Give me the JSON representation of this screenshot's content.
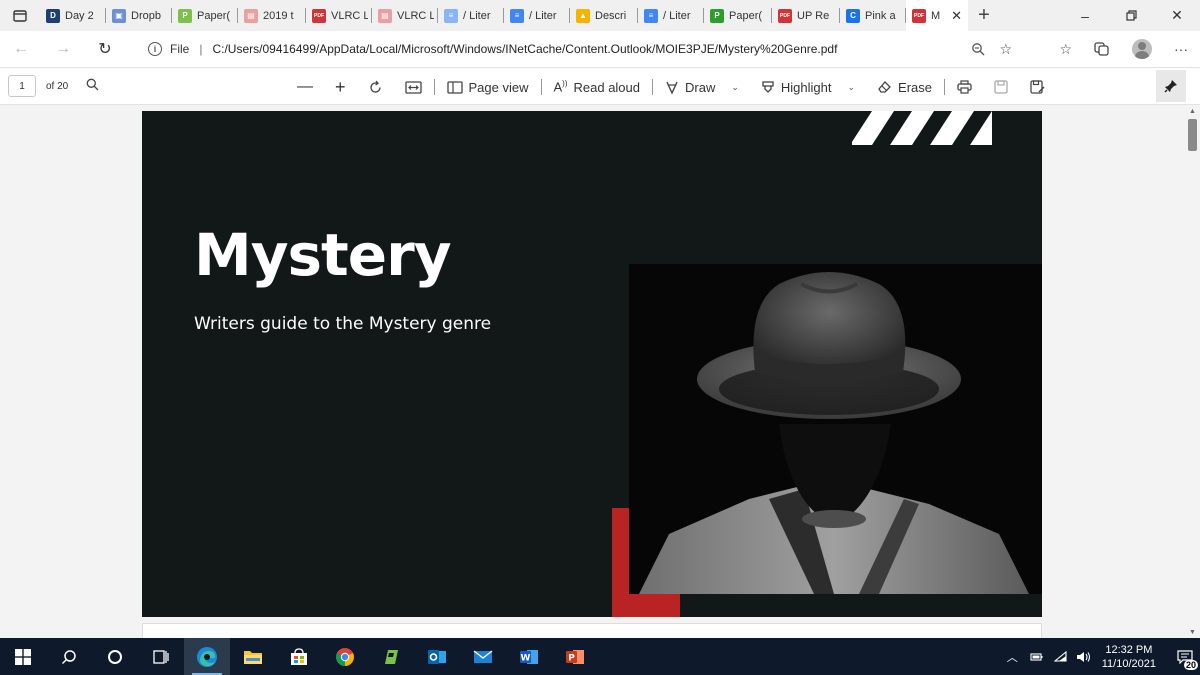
{
  "browser": {
    "tabs": [
      {
        "title": "Day 2",
        "fav_color": "#1d3f73",
        "fav_glyph": "D"
      },
      {
        "title": "Dropb",
        "fav_color": "#6e8fd6",
        "fav_glyph": "▣"
      },
      {
        "title": "Paper(",
        "fav_color": "#7cc24a",
        "fav_glyph": "P"
      },
      {
        "title": "2019 t",
        "fav_color": "#e8a0a0",
        "fav_glyph": "▤"
      },
      {
        "title": "VLRC L",
        "fav_color": "#d13438",
        "fav_glyph": "PDF"
      },
      {
        "title": "VLRC L",
        "fav_color": "#e8a0a0",
        "fav_glyph": "▤"
      },
      {
        "title": "/ Liter",
        "fav_color": "#8ab4f8",
        "fav_glyph": "≡"
      },
      {
        "title": "/ Liter",
        "fav_color": "#4285f4",
        "fav_glyph": "≡"
      },
      {
        "title": "Descri",
        "fav_color": "#f4b400",
        "fav_glyph": "▲"
      },
      {
        "title": "/ Liter",
        "fav_color": "#4285f4",
        "fav_glyph": "≡"
      },
      {
        "title": "Paper(",
        "fav_color": "#2e9c2e",
        "fav_glyph": "P"
      },
      {
        "title": "UP Re",
        "fav_color": "#d13438",
        "fav_glyph": "PDF"
      },
      {
        "title": "Pink a",
        "fav_color": "#1a73e8",
        "fav_glyph": "C"
      },
      {
        "title": "M",
        "fav_color": "#d13438",
        "fav_glyph": "PDF",
        "active": true
      }
    ],
    "address": {
      "scheme_label": "File",
      "url": "C:/Users/09416499/AppData/Local/Microsoft/Windows/INetCache/Content.Outlook/MOIE3PJE/Mystery%20Genre.pdf"
    }
  },
  "pdf_toolbar": {
    "page_number": "1",
    "page_total": "of 20",
    "page_view": "Page view",
    "read_aloud": "Read aloud",
    "draw": "Draw",
    "highlight": "Highlight",
    "erase": "Erase"
  },
  "slide": {
    "title": "Mystery",
    "subtitle": "Writers guide to the Mystery genre",
    "colors": {
      "background": "#121718",
      "accent": "#b92324",
      "text": "#ffffff"
    }
  },
  "taskbar": {
    "time": "12:32 PM",
    "date": "11/10/2021",
    "notification_count": "20"
  }
}
